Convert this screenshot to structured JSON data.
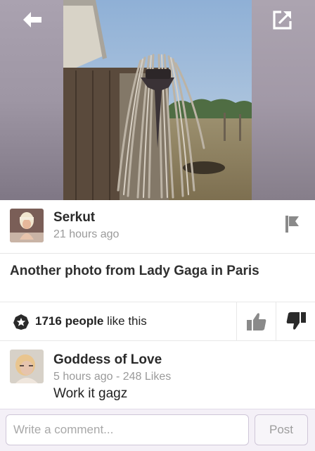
{
  "header": {
    "back_icon": "arrow-left-icon",
    "share_icon": "share-external-icon",
    "photo_icon": "post-photo"
  },
  "post": {
    "author": "Serkut",
    "time": "21 hours ago",
    "caption": "Another photo from Lady Gaga in Paris",
    "flag_icon": "flag-icon"
  },
  "likes": {
    "count": "1716",
    "people": "people",
    "suffix": "like this",
    "badge_icon": "star-badge-icon",
    "up_icon": "thumbs-up-icon",
    "down_icon": "thumbs-down-icon"
  },
  "comments": [
    {
      "name": "Goddess of Love",
      "meta": "5 hours ago - 248 Likes",
      "text": "Work it gagz"
    }
  ],
  "composer": {
    "placeholder": "Write a comment...",
    "post_label": "Post"
  },
  "colors": {
    "accent_purple": "#f4f0f7",
    "icon_gray": "#8a8a8a",
    "badge_dark": "#2a2a2a"
  }
}
